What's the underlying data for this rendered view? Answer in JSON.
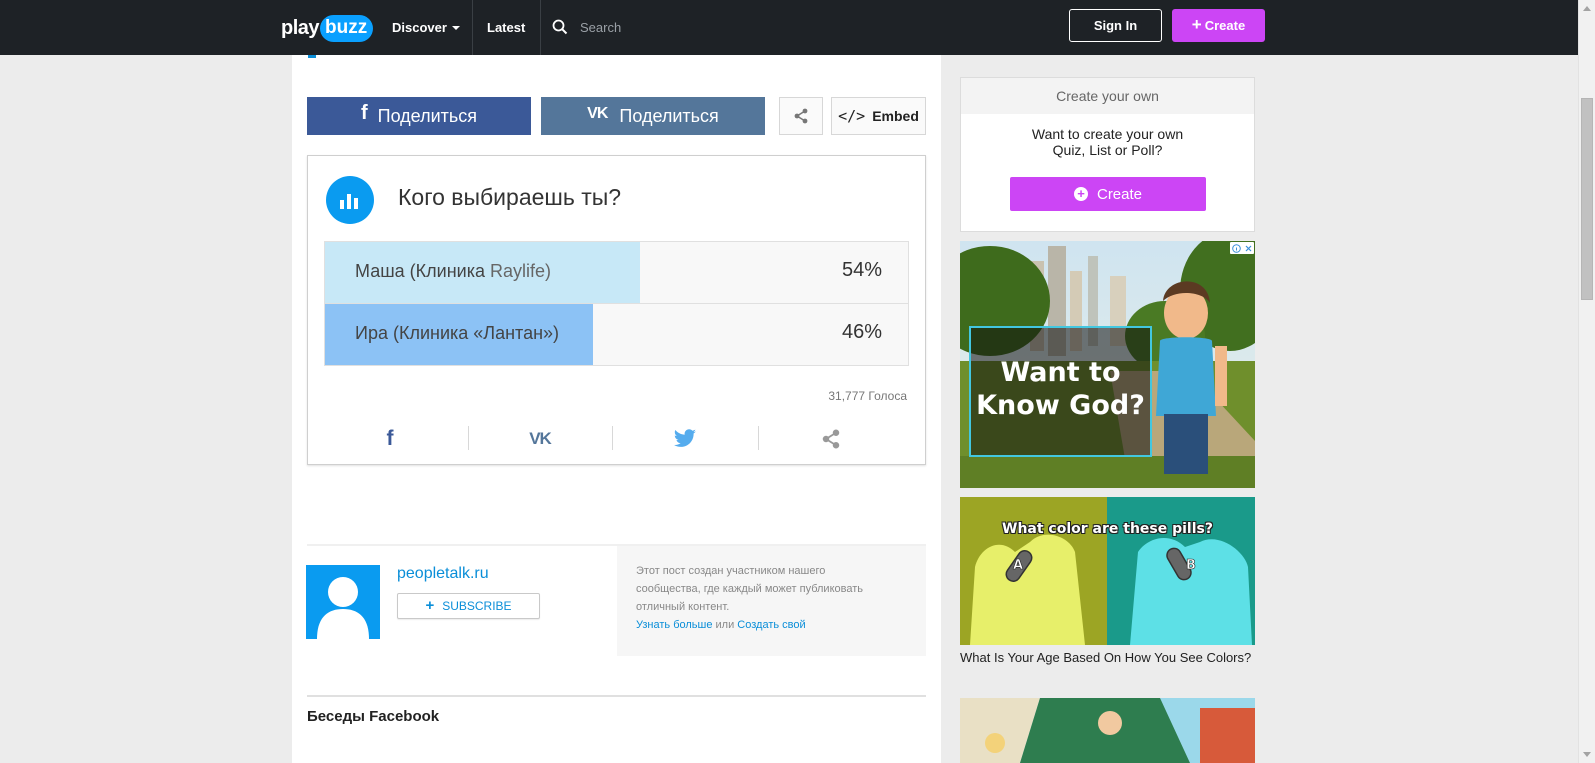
{
  "header": {
    "logo": {
      "play": "play",
      "buzz": "buzz"
    },
    "nav": {
      "discover": "Discover",
      "latest": "Latest"
    },
    "search": {
      "placeholder": "Search",
      "icon": "search-icon"
    },
    "sign_in": "Sign In",
    "create": "Create"
  },
  "share_bar": {
    "facebook": {
      "icon": "f",
      "label": "Поделиться"
    },
    "vk": {
      "icon": "VK",
      "label": "Поделиться"
    },
    "embed": {
      "icon": "</>",
      "label": "Embed"
    }
  },
  "poll": {
    "title": "Кого выбираешь ты?",
    "options": [
      {
        "label_main": "Маша (Клиника ",
        "label_rest": "Raylife)",
        "percent_text": "54%",
        "percent": 54,
        "color": "#c7e8f7"
      },
      {
        "label_main": "Ира (Клиника «Лантан»)",
        "label_rest": "",
        "percent_text": "46%",
        "percent": 46,
        "color": "#8cc2f5"
      }
    ],
    "votes": "31,777 Голоса",
    "share_icons": [
      "facebook-icon",
      "vk-icon",
      "twitter-icon",
      "share-icon"
    ]
  },
  "author": {
    "name": "peopletalk.ru",
    "subscribe": "SUBSCRIBE",
    "info_line1": "Этот пост создан участником нашего",
    "info_line2": "сообщества, где каждый может публиковать",
    "info_line3": "отличный контент.",
    "learn_more": "Узнать больше",
    "or": " или ",
    "create_own": "Создать свой"
  },
  "comments": {
    "title": "Беседы Facebook"
  },
  "sidebar": {
    "create_box": {
      "header": "Create your own",
      "line1": "Want to create your own",
      "line2": "Quiz, List or Poll?",
      "button": "Create"
    },
    "ad1": {
      "line1": "Want to",
      "line2": "Know God?"
    },
    "ad2": {
      "title": "What color are these pills?",
      "label_a": "A",
      "label_b": "B",
      "caption": "What Is Your Age Based On How You See Colors?"
    }
  },
  "colors": {
    "navbar": "#1e2226",
    "accent_purple": "#cc45f5",
    "facebook": "#3b5998",
    "vk": "#54769a",
    "link_blue": "#0a8ed8",
    "poll_icon": "#0a9bf0"
  }
}
